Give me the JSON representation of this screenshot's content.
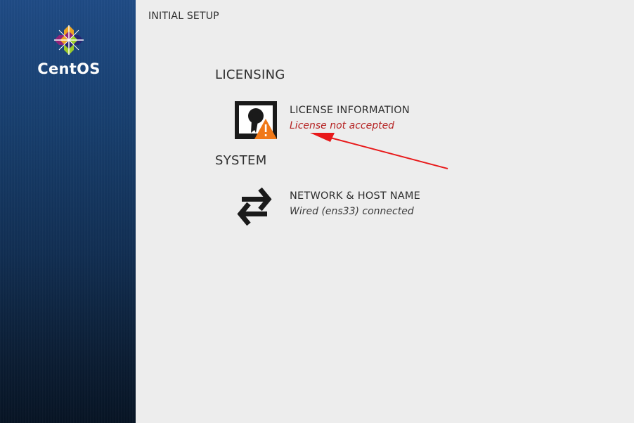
{
  "sidebar": {
    "brand": "CentOS"
  },
  "header": {
    "title": "INITIAL SETUP"
  },
  "sections": {
    "licensing": {
      "title": "LICENSING",
      "spoke": {
        "title": "LICENSE INFORMATION",
        "status": "License not accepted",
        "icon": "license-warning-icon"
      }
    },
    "system": {
      "title": "SYSTEM",
      "spoke": {
        "title": "NETWORK & HOST NAME",
        "status": "Wired (ens33) connected",
        "icon": "network-arrows-icon"
      }
    }
  },
  "colors": {
    "sidebar_top": "#1f4b85",
    "sidebar_bottom": "#071424",
    "warning_text": "#b52222",
    "warning_badge": "#f07818",
    "annotation_arrow": "#e8191a"
  }
}
